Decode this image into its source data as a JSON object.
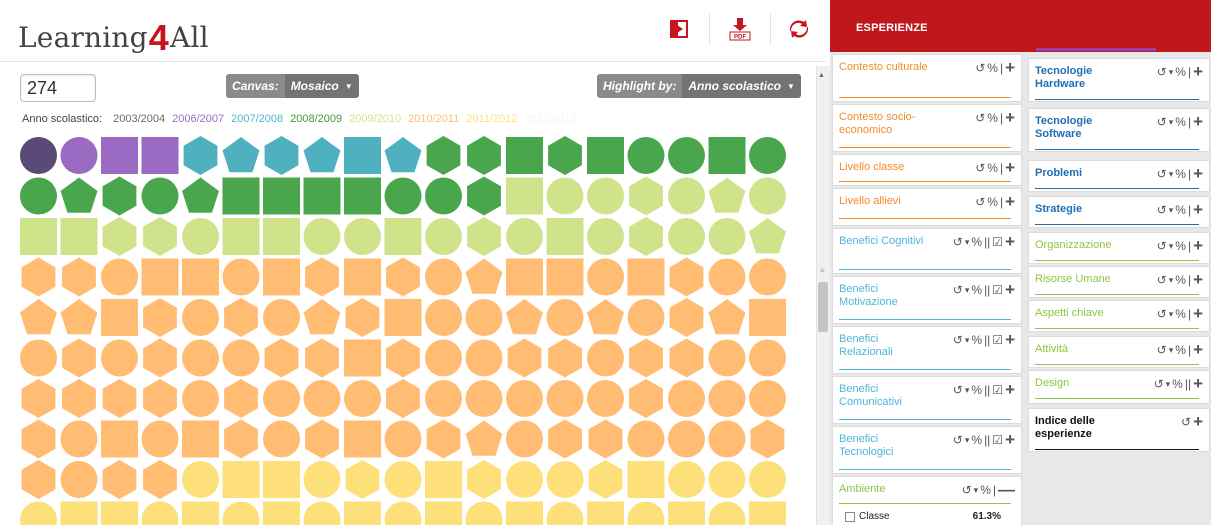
{
  "app": {
    "logo_prefix": "Learning",
    "logo_four": "4",
    "logo_suffix": "All"
  },
  "header_icons": {
    "exit": "exit-icon",
    "pdf": "pdf-download-icon",
    "pdf_label": "PDF",
    "sync": "sync-icon"
  },
  "toolbar": {
    "count": "274",
    "canvas_label": "Canvas:",
    "canvas_value": "Mosaico",
    "highlight_label": "Highlight by:",
    "highlight_value": "Anno scolastico"
  },
  "legend": {
    "label": "Anno scolastico:",
    "items": [
      {
        "text": "2003/2004",
        "color": "#6a6a6a"
      },
      {
        "text": "2006/2007",
        "color": "#9b6dc5"
      },
      {
        "text": "2007/2008",
        "color": "#4eb7c7"
      },
      {
        "text": "2008/2009",
        "color": "#3f9a3f"
      },
      {
        "text": "2009/2010",
        "color": "#d7e48a"
      },
      {
        "text": "2010/2011",
        "color": "#ffbe7a"
      },
      {
        "text": "2011/2012",
        "color": "#ffe27a"
      },
      {
        "text": "2012/2013",
        "color": "#f4f4f4"
      }
    ]
  },
  "mosaic": {
    "colors": {
      "dp": "#5a4a78",
      "pu": "#9b6ac3",
      "te": "#4fb0c0",
      "gr": "#4aa64c",
      "lg": "#d0e28a",
      "or": "#ffbc72",
      "ye": "#fde07a"
    },
    "rows": [
      [
        "dp:c",
        "pu:c",
        "pu:s",
        "pu:s",
        "te:h",
        "te:p",
        "te:h",
        "te:p",
        "te:s",
        "te:p",
        "gr:h",
        "gr:h",
        "gr:s",
        "gr:h",
        "gr:s",
        "gr:c",
        "gr:c",
        "gr:s",
        "gr:c"
      ],
      [
        "gr:c",
        "gr:p",
        "gr:h",
        "gr:c",
        "gr:p",
        "gr:s",
        "gr:s",
        "gr:s",
        "gr:s",
        "gr:c",
        "gr:c",
        "gr:h",
        "lg:s",
        "lg:c",
        "lg:c",
        "lg:h",
        "lg:c",
        "lg:p",
        "lg:c"
      ],
      [
        "lg:s",
        "lg:s",
        "lg:h",
        "lg:h",
        "lg:c",
        "lg:s",
        "lg:s",
        "lg:c",
        "lg:c",
        "lg:s",
        "lg:c",
        "lg:h",
        "lg:c",
        "lg:s",
        "lg:c",
        "lg:h",
        "lg:c",
        "lg:c",
        "lg:p"
      ],
      [
        "or:h",
        "or:h",
        "or:c",
        "or:s",
        "or:s",
        "or:c",
        "or:s",
        "or:h",
        "or:s",
        "or:h",
        "or:c",
        "or:p",
        "or:s",
        "or:s",
        "or:c",
        "or:s",
        "or:h",
        "or:c",
        "or:c"
      ],
      [
        "or:p",
        "or:p",
        "or:s",
        "or:h",
        "or:c",
        "or:h",
        "or:c",
        "or:p",
        "or:h",
        "or:s",
        "or:c",
        "or:c",
        "or:p",
        "or:c",
        "or:p",
        "or:c",
        "or:h",
        "or:p",
        "or:s"
      ],
      [
        "or:c",
        "or:h",
        "or:c",
        "or:h",
        "or:c",
        "or:c",
        "or:h",
        "or:h",
        "or:s",
        "or:h",
        "or:c",
        "or:c",
        "or:h",
        "or:h",
        "or:c",
        "or:h",
        "or:h",
        "or:c",
        "or:c"
      ],
      [
        "or:h",
        "or:h",
        "or:h",
        "or:h",
        "or:c",
        "or:h",
        "or:c",
        "or:c",
        "or:c",
        "or:h",
        "or:c",
        "or:c",
        "or:c",
        "or:c",
        "or:c",
        "or:h",
        "or:c",
        "or:c",
        "or:c"
      ],
      [
        "or:h",
        "or:c",
        "or:s",
        "or:c",
        "or:s",
        "or:h",
        "or:c",
        "or:h",
        "or:s",
        "or:c",
        "or:h",
        "or:p",
        "or:c",
        "or:h",
        "or:h",
        "or:c",
        "or:c",
        "or:c",
        "or:h"
      ],
      [
        "or:h",
        "or:c",
        "or:h",
        "or:h",
        "ye:c",
        "ye:s",
        "ye:s",
        "ye:c",
        "ye:h",
        "ye:c",
        "ye:s",
        "ye:h",
        "ye:c",
        "ye:c",
        "ye:h",
        "ye:s",
        "ye:c",
        "ye:c",
        "ye:c"
      ],
      [
        "ye:c",
        "ye:s",
        "ye:s",
        "ye:c",
        "ye:s",
        "ye:c",
        "ye:s",
        "ye:c",
        "ye:s",
        "ye:c",
        "ye:s",
        "ye:c",
        "ye:s",
        "ye:c",
        "ye:s",
        "ye:c",
        "ye:s",
        "ye:c",
        "ye:s"
      ]
    ]
  },
  "panel": {
    "title": "ESPERIENZE",
    "left_cards": [
      {
        "label": "Contesto culturale",
        "color": "#f28c28",
        "ctrls": "basic",
        "bold": false
      },
      {
        "label": "Contesto socio-economico",
        "color": "#f28c28",
        "ctrls": "basic",
        "bold": false
      },
      {
        "label": "Livello classe",
        "color": "#f28c28",
        "ctrls": "basic",
        "bold": false
      },
      {
        "label": "Livello allievi",
        "color": "#f28c28",
        "ctrls": "basic",
        "bold": false
      },
      {
        "label": "Benefici Cognitivi",
        "color": "#4db6d8",
        "ctrls": "check",
        "bold": false
      },
      {
        "label": "Benefici Motivazione",
        "color": "#4db6d8",
        "ctrls": "check",
        "bold": false
      },
      {
        "label": "Benefici Relazionali",
        "color": "#4db6d8",
        "ctrls": "check",
        "bold": false
      },
      {
        "label": "Benefici Comunicativi",
        "color": "#4db6d8",
        "ctrls": "check",
        "bold": false
      },
      {
        "label": "Benefici Tecnologici",
        "color": "#4db6d8",
        "ctrls": "check",
        "bold": false
      },
      {
        "label": "Ambiente",
        "color": "#8dc63f",
        "ctrls": "minus",
        "bold": false
      }
    ],
    "right_cards": [
      {
        "label": "Tecnologie Hardware",
        "color": "#1f6fb5",
        "ctrls": "drop",
        "bold": true
      },
      {
        "label": "Tecnologie Software",
        "color": "#1f6fb5",
        "ctrls": "drop",
        "bold": true
      },
      {
        "label": "Problemi",
        "color": "#1f6fb5",
        "ctrls": "drop",
        "bold": true
      },
      {
        "label": "Strategie",
        "color": "#1f6fb5",
        "ctrls": "drop",
        "bold": true
      },
      {
        "label": "Organizzazione",
        "color": "#8dc63f",
        "ctrls": "drop",
        "bold": false
      },
      {
        "label": "Risorse Umane",
        "color": "#8dc63f",
        "ctrls": "drop",
        "bold": false
      },
      {
        "label": "Aspetti chiave",
        "color": "#8dc63f",
        "ctrls": "drop",
        "bold": false
      },
      {
        "label": "Attività",
        "color": "#8dc63f",
        "ctrls": "drop",
        "bold": false
      },
      {
        "label": "Design",
        "color": "#8dc63f",
        "ctrls": "drop2",
        "bold": false
      },
      {
        "label": "Indice delle esperienze",
        "color": "#111111",
        "ctrls": "reset",
        "bold": true
      }
    ],
    "ambiente_option": {
      "label": "Classe",
      "percent": "61.3%"
    },
    "controls": {
      "reset": "↺",
      "caret": "▾",
      "percent": "%",
      "bar": "|",
      "dbar": "||",
      "check": "☑",
      "plus": "+",
      "minus": "—"
    }
  }
}
